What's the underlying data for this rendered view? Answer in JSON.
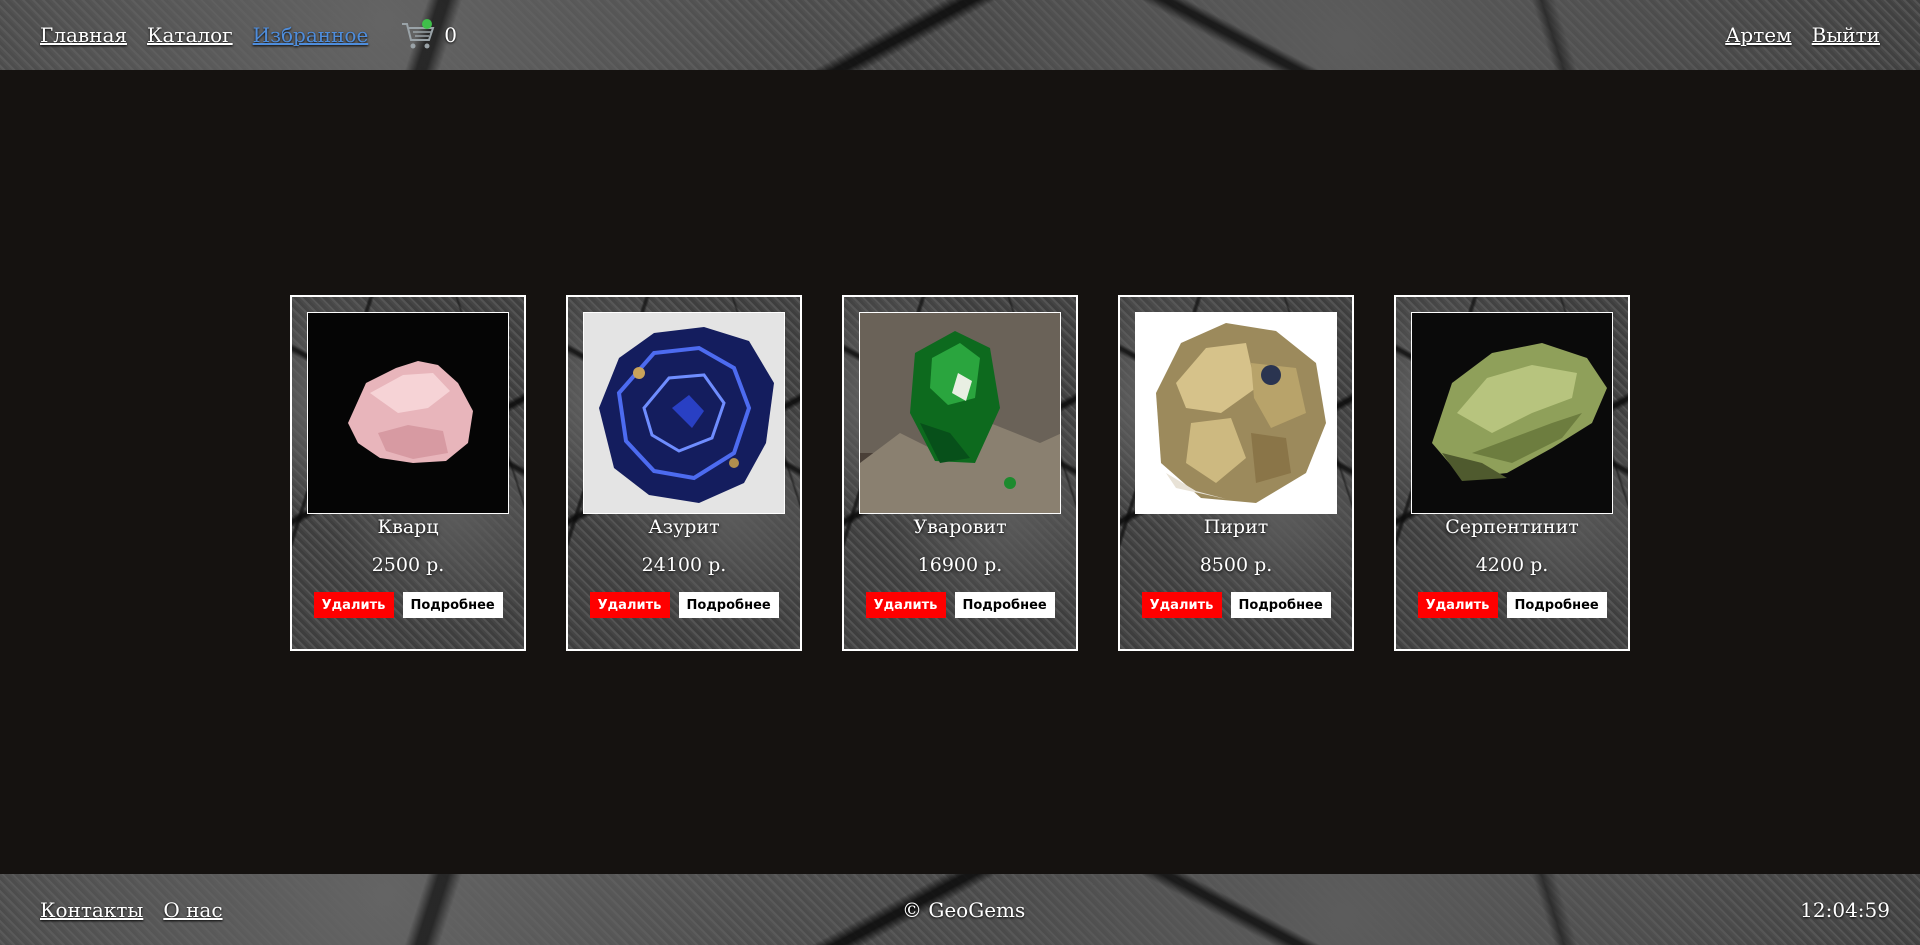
{
  "header": {
    "nav": [
      {
        "label": "Главная"
      },
      {
        "label": "Каталог"
      },
      {
        "label": "Избранное"
      }
    ],
    "cart_count": "0",
    "user_name": "Артем",
    "logout_label": "Выйти"
  },
  "favorites": [
    {
      "name": "Кварц",
      "price": "2500 р.",
      "remove_label": "Удалить",
      "details_label": "Подробнее"
    },
    {
      "name": "Азурит",
      "price": "24100 р.",
      "remove_label": "Удалить",
      "details_label": "Подробнее"
    },
    {
      "name": "Уваровит",
      "price": "16900 р.",
      "remove_label": "Удалить",
      "details_label": "Подробнее"
    },
    {
      "name": "Пирит",
      "price": "8500 р.",
      "remove_label": "Удалить",
      "details_label": "Подробнее"
    },
    {
      "name": "Серпентинит",
      "price": "4200 р.",
      "remove_label": "Удалить",
      "details_label": "Подробнее"
    }
  ],
  "footer": {
    "contacts_label": "Контакты",
    "about_label": "О нас",
    "copyright": "© GeoGems",
    "clock": "12:04:59"
  },
  "colors": {
    "page_background": "#151210",
    "active_link": "#4f8ddb",
    "remove_button": "#ff0000",
    "details_button": "#ffffff"
  }
}
